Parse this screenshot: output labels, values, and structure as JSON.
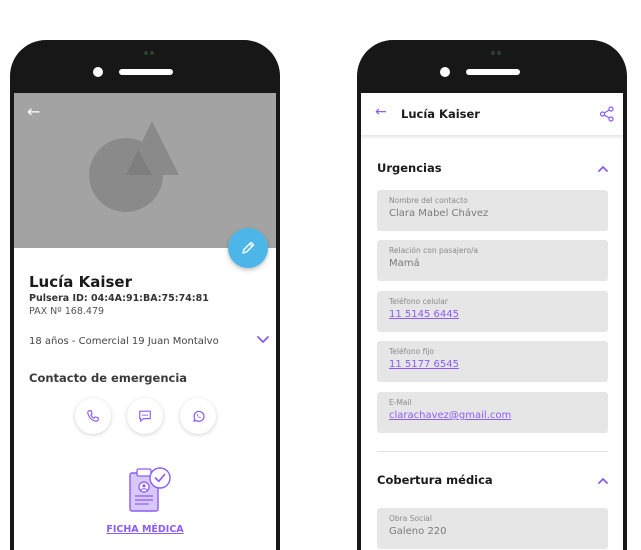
{
  "profile_screen": {
    "name": "Lucía Kaiser",
    "pulsera_id": "Pulsera ID: 04:4A:91:BA:75:74:81",
    "pax": "PAX Nº 168.479",
    "details": "18 años - Comercial 19 Juan Montalvo",
    "emergency_title": "Contacto de emergencia",
    "ficha_label": "FICHA MÉDICA",
    "back_icon": "arrow-left-icon",
    "edit_icon": "pencil-icon",
    "contact_icons": [
      "phone-icon",
      "message-icon",
      "whatsapp-icon"
    ]
  },
  "detail_screen": {
    "title": "Lucía Kaiser",
    "share_icon": "share-icon",
    "sections": [
      {
        "title": "Urgencias",
        "fields": [
          {
            "label": "Nombre del contacto",
            "value": "Clara Mabel Chávez",
            "link": false
          },
          {
            "label": "Relación con pasajero/a",
            "value": "Mamá",
            "link": false
          },
          {
            "label": "Teléfono celular",
            "value": "11 5145 6445",
            "link": true
          },
          {
            "label": "Teléfono fijo",
            "value": "11 5177 6545",
            "link": true
          },
          {
            "label": "E-Mail",
            "value": "clarachavez@gmail.com",
            "link": true
          }
        ]
      },
      {
        "title": "Cobertura médica",
        "fields": [
          {
            "label": "Obra Social",
            "value": "Galeno 220",
            "link": false
          }
        ]
      }
    ]
  },
  "colors": {
    "accent": "#8b5cf6",
    "fab": "#4db6e8",
    "hero": "#a3a3a3",
    "field_bg": "#e6e6e6"
  }
}
